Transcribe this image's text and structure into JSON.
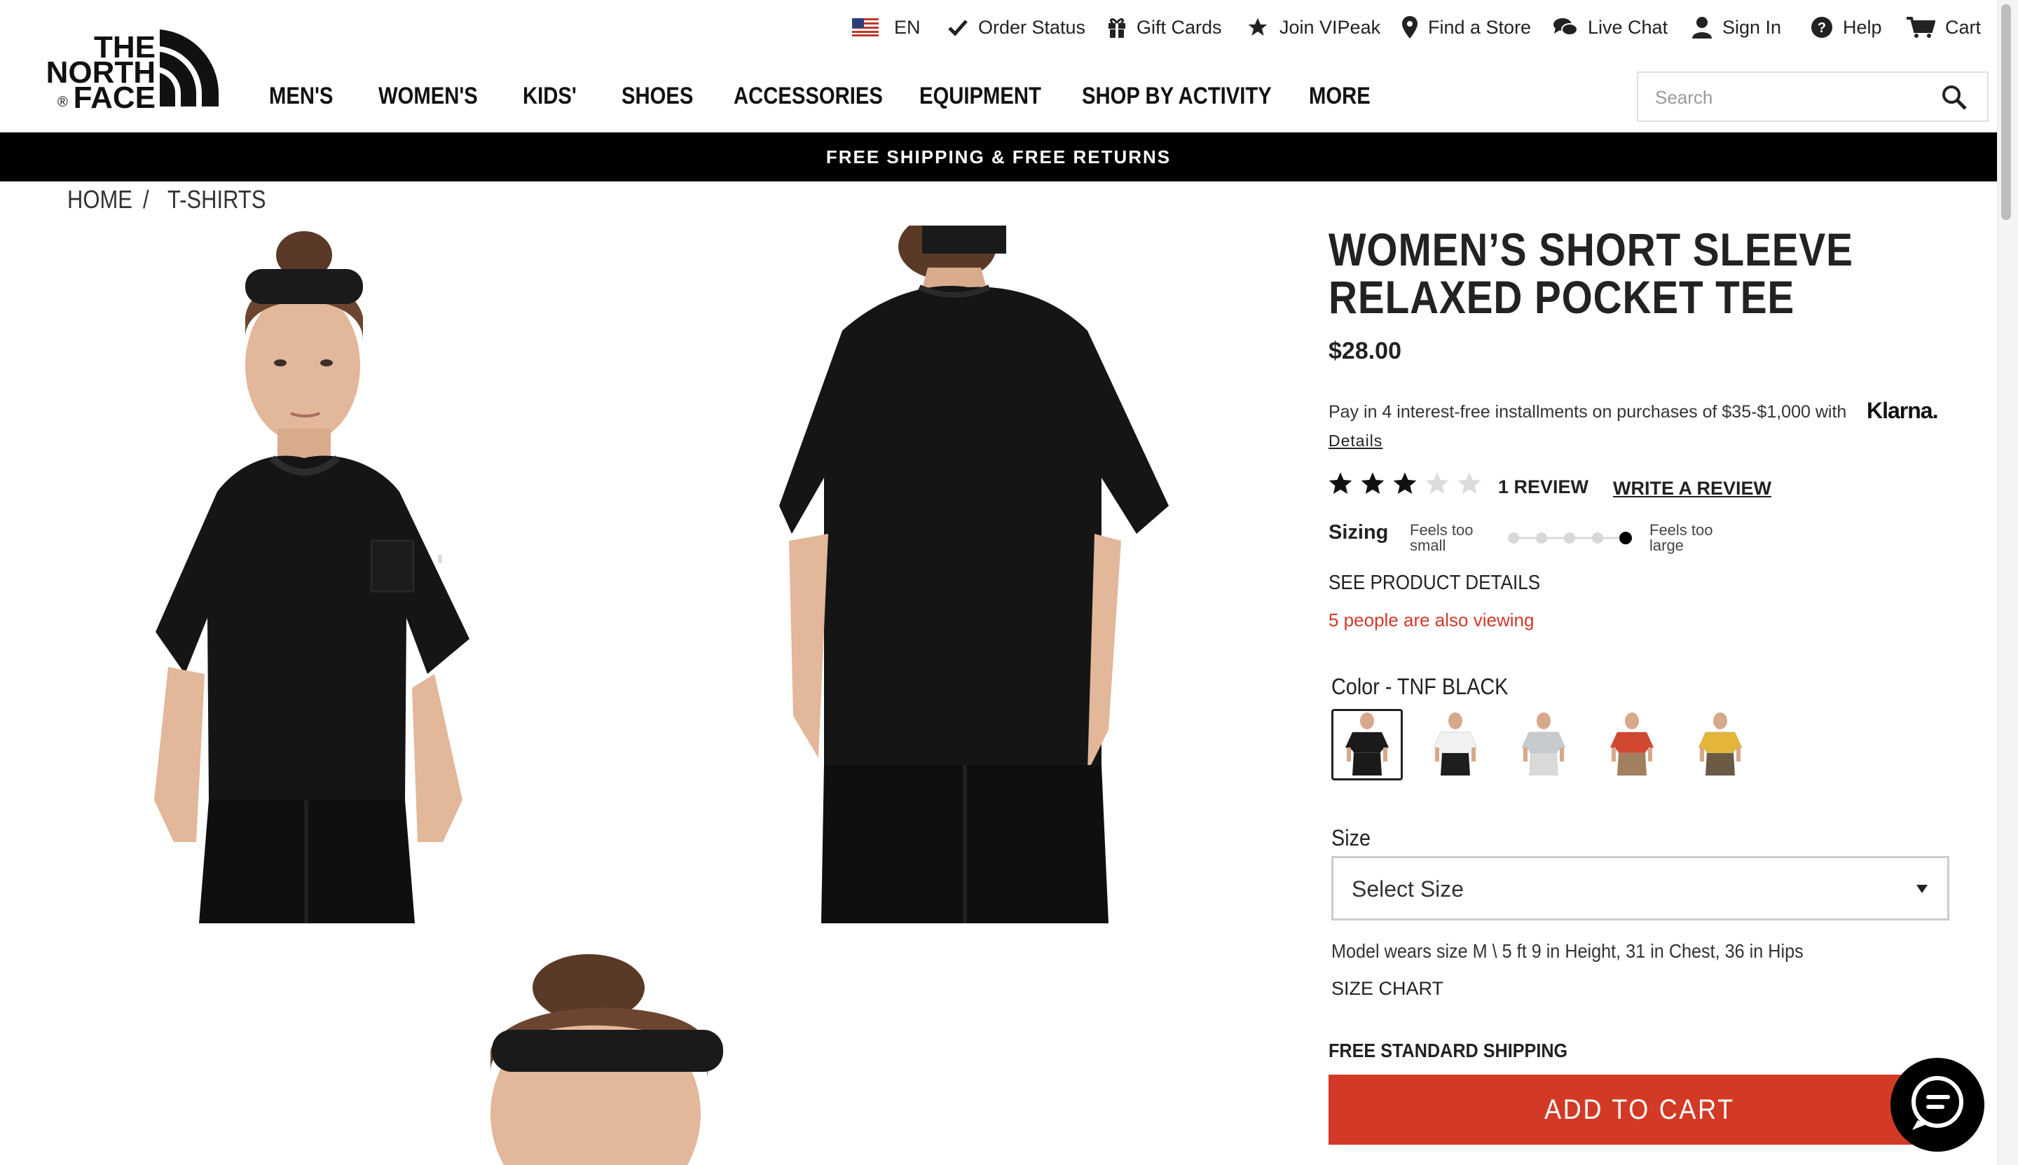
{
  "brand": {
    "logo_lines": [
      "THE",
      "NORTH",
      "FACE"
    ],
    "registered": "®"
  },
  "utility_nav": [
    {
      "label": "EN",
      "icon": "us-flag-icon"
    },
    {
      "label": "Order Status",
      "icon": "checkmark-icon"
    },
    {
      "label": "Gift Cards",
      "icon": "gift-icon"
    },
    {
      "label": "Join VIPeak",
      "icon": "star-icon"
    },
    {
      "label": "Find a Store",
      "icon": "location-pin-icon"
    },
    {
      "label": "Live Chat",
      "icon": "chat-bubbles-icon"
    },
    {
      "label": "Sign In",
      "icon": "user-icon"
    },
    {
      "label": "Help",
      "icon": "help-circle-icon"
    },
    {
      "label": "Cart",
      "icon": "cart-icon"
    }
  ],
  "main_nav": [
    "MEN'S",
    "WOMEN'S",
    "KIDS'",
    "SHOES",
    "ACCESSORIES",
    "EQUIPMENT",
    "SHOP BY ACTIVITY",
    "MORE"
  ],
  "search": {
    "placeholder": "Search"
  },
  "promo_bar": "FREE SHIPPING & FREE RETURNS",
  "breadcrumb": {
    "home": "HOME",
    "separator": "/",
    "current": "T-SHIRTS"
  },
  "product": {
    "title_line1": "WOMEN’S SHORT SLEEVE",
    "title_line2": "RELAXED POCKET TEE",
    "price": "$28.00",
    "klarna_text": "Pay in 4 interest-free installments on purchases of $35-$1,000 with",
    "klarna_brand": "Klarna.",
    "klarna_details": "Details",
    "rating": 3,
    "rating_max": 5,
    "review_count": "1 REVIEW",
    "write_review": "WRITE A REVIEW",
    "sizing_label": "Sizing",
    "sizing_small": [
      "Feels too",
      "small"
    ],
    "sizing_large": [
      "Feels too",
      "large"
    ],
    "sizing_value": 5,
    "sizing_steps": 5,
    "see_details": "SEE PRODUCT DETAILS",
    "viewing": "5 people are also viewing",
    "color_label": "Color",
    "color_sep": " - ",
    "color_value": "TNF BLACK",
    "colors": [
      {
        "name": "TNF Black",
        "shirt": "#1a1a1a",
        "pants": "#1a1a1a",
        "selected": true
      },
      {
        "name": "TNF White",
        "shirt": "#f2f2f2",
        "pants": "#1e1e1e",
        "selected": false
      },
      {
        "name": "Light Grey Heather",
        "shirt": "#c8cbcd",
        "pants": "#d9d9d9",
        "selected": false
      },
      {
        "name": "Fiery Red",
        "shirt": "#d1472f",
        "pants": "#a0805e",
        "selected": false
      },
      {
        "name": "Yellow",
        "shirt": "#e3b63a",
        "pants": "#6b5a44",
        "selected": false
      }
    ],
    "size_label": "Size",
    "size_select": "Select Size",
    "model_info": "Model wears size M \\ 5 ft 9 in Height, 31 in Chest, 36 in Hips",
    "size_chart": "SIZE CHART",
    "free_shipping": "FREE STANDARD SHIPPING",
    "add_to_cart": "ADD TO CART"
  },
  "colors": {
    "accent_red": "#d33a26",
    "viewing_red": "#d0392b",
    "promo_bg": "#000000"
  }
}
